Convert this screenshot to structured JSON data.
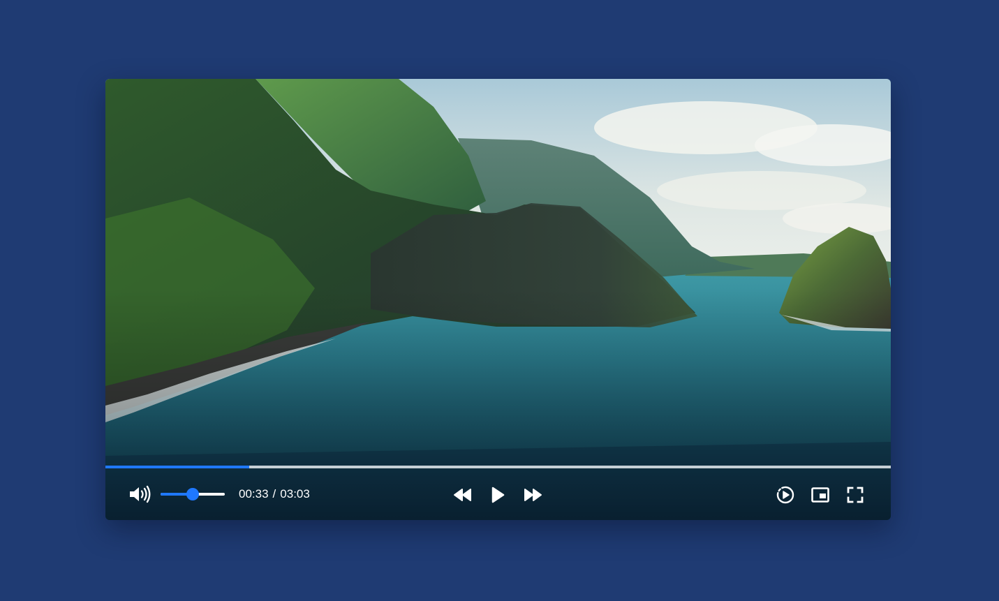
{
  "player": {
    "progress_fraction": 0.183,
    "volume_fraction": 0.5,
    "current_time": "00:33",
    "time_separator": "/",
    "duration": "03:03"
  },
  "colors": {
    "page_background": "#1f3b73",
    "accent": "#1f78ff",
    "icon": "#ffffff"
  },
  "icons": {
    "volume": "volume-high-icon",
    "rewind": "rewind-icon",
    "play": "play-icon",
    "fast_forward": "fast-forward-icon",
    "playback_speed": "playback-speed-icon",
    "picture_in_picture": "picture-in-picture-icon",
    "fullscreen": "fullscreen-icon"
  }
}
